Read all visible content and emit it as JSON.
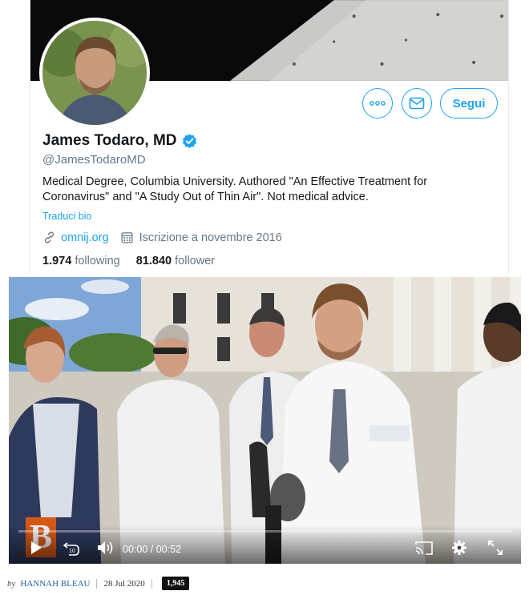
{
  "profile": {
    "name": "James Todaro, MD",
    "handle": "@JamesTodaroMD",
    "bio": "Medical Degree, Columbia University. Authored \"An Effective Treatment for Coronavirus\" and \"A Study Out of Thin Air\". Not medical advice.",
    "translate_label": "Traduci bio",
    "website": "omnij.org",
    "joined": "Iscrizione a novembre 2016",
    "following_count": "1.974",
    "following_label": "following",
    "follower_count": "81.840",
    "follower_label": "follower",
    "follow_button": "Segui",
    "accent_color": "#1da1f2",
    "icons": [
      "more-icon",
      "mail-icon",
      "verified-icon",
      "link-icon",
      "calendar-icon"
    ]
  },
  "video": {
    "current_time": "00:00",
    "separator": "/",
    "duration": "00:52",
    "brand_letter": "B",
    "icons": [
      "play-icon",
      "replay-10-icon",
      "volume-icon",
      "cast-icon",
      "settings-icon",
      "fullscreen-icon"
    ]
  },
  "byline": {
    "by": "by",
    "author": "HANNAH BLEAU",
    "date": "28 Jul 2020",
    "comment_count": "1,945"
  }
}
